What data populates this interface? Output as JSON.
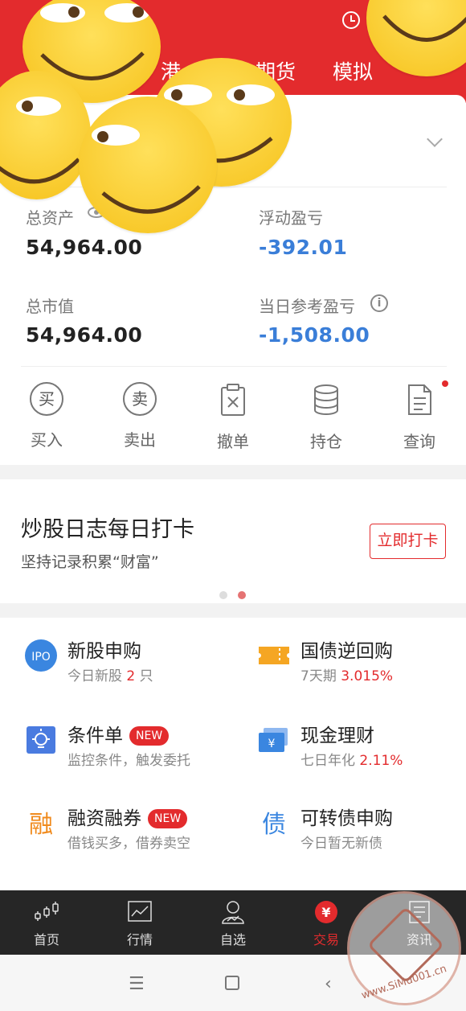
{
  "header": {
    "tabs_visible": [
      "港",
      "期货",
      "模拟"
    ],
    "alarm_icon": "alarm-clock-icon"
  },
  "summary": {
    "total_assets_label": "总资产",
    "total_assets_value": "54,964.00",
    "floating_pl_label": "浮动盈亏",
    "floating_pl_value": "-392.01",
    "market_value_label": "总市值",
    "market_value_value": "54,964.00",
    "daily_pl_label": "当日参考盈亏",
    "daily_pl_value": "-1,508.00"
  },
  "actions": [
    {
      "label": "买入",
      "glyph": "买",
      "icon": "buy-icon"
    },
    {
      "label": "卖出",
      "glyph": "卖",
      "icon": "sell-icon"
    },
    {
      "label": "撤单",
      "icon": "cancel-order-icon"
    },
    {
      "label": "持仓",
      "icon": "holdings-icon"
    },
    {
      "label": "查询",
      "icon": "query-icon"
    }
  ],
  "banner": {
    "title": "炒股日志每日打卡",
    "subtitle": "坚持记录积累“财富”",
    "button": "立即打卡",
    "page_count": 2,
    "active_page": 2
  },
  "services": [
    {
      "title": "新股申购",
      "sub_prefix": "今日新股 ",
      "sub_highlight": "2",
      "sub_suffix": " 只",
      "badge": "",
      "icon": "ipo-icon",
      "glyph": "IPO"
    },
    {
      "title": "国债逆回购",
      "sub_prefix": "7天期 ",
      "sub_highlight": "3.015%",
      "sub_suffix": "",
      "badge": "",
      "icon": "bond-repo-ticket-icon"
    },
    {
      "title": "条件单",
      "sub_prefix": "监控条件，触发委托",
      "sub_highlight": "",
      "sub_suffix": "",
      "badge": "NEW",
      "icon": "condition-order-bulb-icon"
    },
    {
      "title": "现金理财",
      "sub_prefix": "七日年化 ",
      "sub_highlight": "2.11%",
      "sub_suffix": "",
      "badge": "",
      "icon": "cash-wallet-icon",
      "glyph": "¥"
    },
    {
      "title": "融资融券",
      "sub_prefix": "借钱买多，借券卖空",
      "sub_highlight": "",
      "sub_suffix": "",
      "badge": "NEW",
      "icon": "margin-trading-icon",
      "glyph": "融"
    },
    {
      "title": "可转债申购",
      "sub_prefix": "今日暂无新债",
      "sub_highlight": "",
      "sub_suffix": "",
      "badge": "",
      "icon": "convertible-bond-icon",
      "glyph": "债"
    }
  ],
  "bottom_nav": [
    {
      "label": "首页",
      "icon": "home-candlestick-icon",
      "active": false
    },
    {
      "label": "行情",
      "icon": "market-chart-icon",
      "active": false
    },
    {
      "label": "自选",
      "icon": "watchlist-person-icon",
      "active": false
    },
    {
      "label": "交易",
      "icon": "trade-yen-icon",
      "active": true,
      "glyph": "¥"
    },
    {
      "label": "资讯",
      "icon": "news-icon",
      "active": false
    }
  ],
  "watermark": {
    "text": "www.SiMu001.cn"
  },
  "colors": {
    "brand_red": "#e32b2d",
    "loss_blue": "#3a7ed8",
    "nav_bg": "#262626"
  }
}
